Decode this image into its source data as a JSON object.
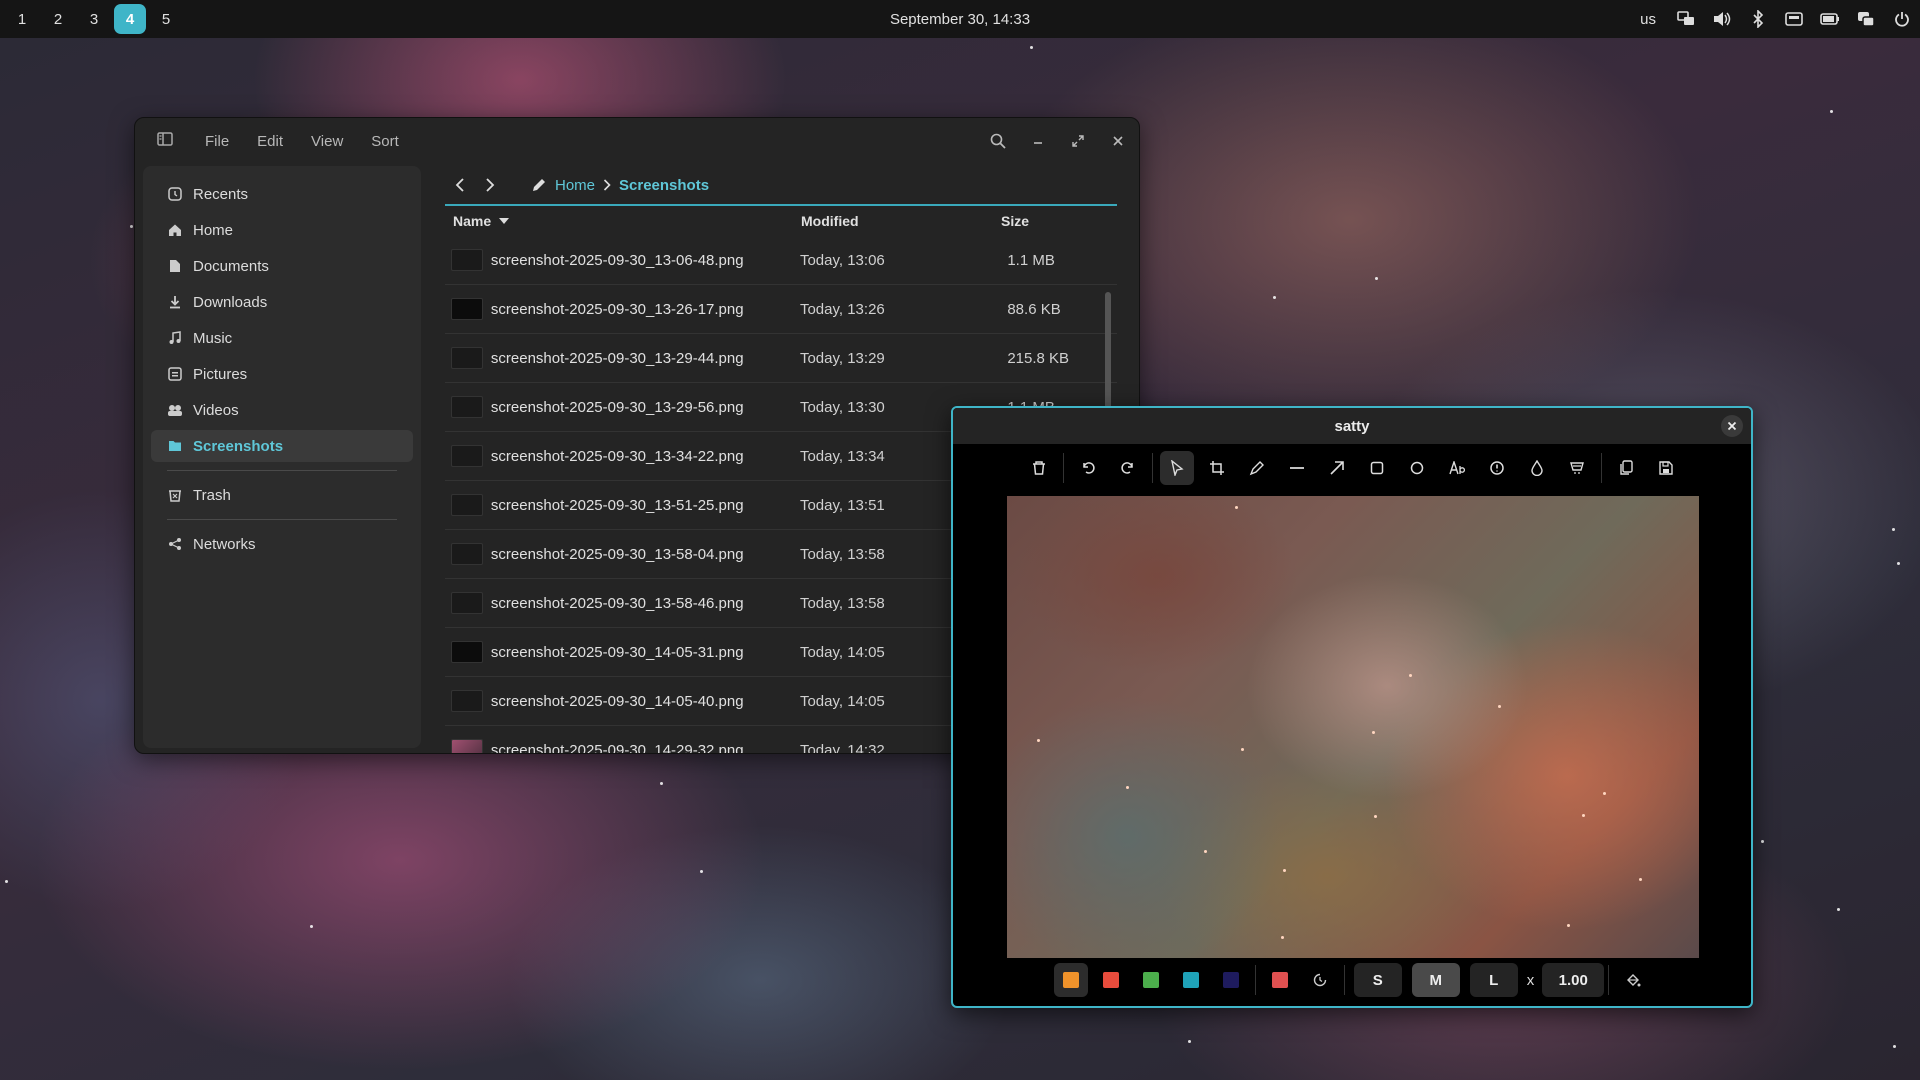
{
  "topbar": {
    "workspaces": [
      "1",
      "2",
      "3",
      "4",
      "5"
    ],
    "active_workspace": "4",
    "clock": "September 30, 14:33",
    "keyboard_layout": "us",
    "tray_icons": [
      "network-icon",
      "volume-icon",
      "bluetooth-icon",
      "screenshot-icon",
      "battery-icon",
      "notifications-icon",
      "power-icon"
    ]
  },
  "file_manager": {
    "menu": [
      "File",
      "Edit",
      "View",
      "Sort"
    ],
    "sidebar": {
      "items": [
        {
          "label": "Recents",
          "icon": "clock-icon"
        },
        {
          "label": "Home",
          "icon": "home-icon"
        },
        {
          "label": "Documents",
          "icon": "document-icon"
        },
        {
          "label": "Downloads",
          "icon": "download-icon"
        },
        {
          "label": "Music",
          "icon": "music-icon"
        },
        {
          "label": "Pictures",
          "icon": "pictures-icon"
        },
        {
          "label": "Videos",
          "icon": "videos-icon"
        },
        {
          "label": "Screenshots",
          "icon": "folder-icon"
        },
        {
          "label": "Trash",
          "icon": "trash-icon"
        },
        {
          "label": "Networks",
          "icon": "network-icon"
        }
      ],
      "active": "Screenshots"
    },
    "breadcrumb": {
      "home": "Home",
      "current": "Screenshots"
    },
    "columns": {
      "name": "Name",
      "modified": "Modified",
      "size": "Size"
    },
    "files": [
      {
        "name": "screenshot-2025-09-30_13-06-48.png",
        "modified": "Today, 13:06",
        "size": "1.1 MB"
      },
      {
        "name": "screenshot-2025-09-30_13-26-17.png",
        "modified": "Today, 13:26",
        "size": "88.6 KB"
      },
      {
        "name": "screenshot-2025-09-30_13-29-44.png",
        "modified": "Today, 13:29",
        "size": "215.8 KB"
      },
      {
        "name": "screenshot-2025-09-30_13-29-56.png",
        "modified": "Today, 13:30",
        "size": "1.1 MB"
      },
      {
        "name": "screenshot-2025-09-30_13-34-22.png",
        "modified": "Today, 13:34",
        "size": ""
      },
      {
        "name": "screenshot-2025-09-30_13-51-25.png",
        "modified": "Today, 13:51",
        "size": ""
      },
      {
        "name": "screenshot-2025-09-30_13-58-04.png",
        "modified": "Today, 13:58",
        "size": ""
      },
      {
        "name": "screenshot-2025-09-30_13-58-46.png",
        "modified": "Today, 13:58",
        "size": ""
      },
      {
        "name": "screenshot-2025-09-30_14-05-31.png",
        "modified": "Today, 14:05",
        "size": ""
      },
      {
        "name": "screenshot-2025-09-30_14-05-40.png",
        "modified": "Today, 14:05",
        "size": ""
      },
      {
        "name": "screenshot-2025-09-30_14-29-32.png",
        "modified": "Today, 14:32",
        "size": ""
      }
    ]
  },
  "satty": {
    "title": "satty",
    "tools": [
      "trash-icon",
      "undo-icon",
      "redo-icon",
      "pointer-icon",
      "crop-icon",
      "brush-icon",
      "line-icon",
      "arrow-icon",
      "rectangle-icon",
      "ellipse-icon",
      "text-icon",
      "marker-icon",
      "blur-icon",
      "highlight-icon",
      "copy-icon",
      "save-icon"
    ],
    "selected_tool": "pointer-icon",
    "palette": [
      "#f0932b",
      "#e74c3c",
      "#4cae4c",
      "#1fa2b8",
      "#1e1b5e"
    ],
    "custom_color": "#e05050",
    "sizes": [
      "S",
      "M",
      "L"
    ],
    "selected_size": "M",
    "multiplier_symbol": "x",
    "factor": "1.00"
  }
}
